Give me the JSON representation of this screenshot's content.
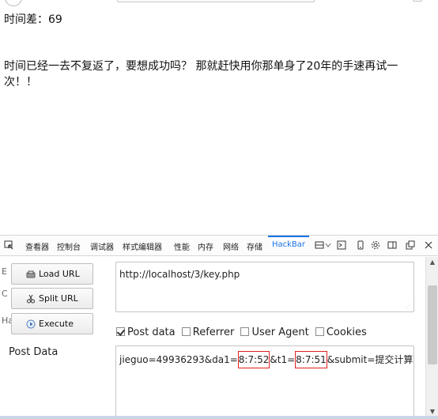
{
  "page": {
    "time_diff": "时间差：69",
    "message": "时间已经一去不复返了，要想成功吗？ 那就赶快用你那单身了20年的手速再试一次！！"
  },
  "devtools": {
    "tabs": [
      "查看器",
      "控制台",
      "调试器",
      "样式编辑器",
      "性能",
      "内存",
      "网络",
      "存储",
      "HackBar"
    ],
    "active_tab": "HackBar",
    "accent_color": "#1a73e8"
  },
  "hackbar": {
    "side_letters": [
      "E",
      "C",
      "Ha"
    ],
    "buttons": {
      "load_url": "Load URL",
      "split_url": "Split URL",
      "execute": "Execute"
    },
    "url_value": "http://localhost/3/key.php",
    "checkboxes": [
      {
        "label": "Post data",
        "checked": true
      },
      {
        "label": "Referrer",
        "checked": false
      },
      {
        "label": "User Agent",
        "checked": false
      },
      {
        "label": "Cookies",
        "checked": false
      }
    ],
    "post_data_label": "Post Data",
    "post_data": {
      "part1": "jieguo=49936293&da1=",
      "highlight1": "8:7:52",
      "part2": "&t1=",
      "highlight2": "8:7:51",
      "part3": "&submit=提交计算结果"
    },
    "highlight_color": "#e02020"
  }
}
